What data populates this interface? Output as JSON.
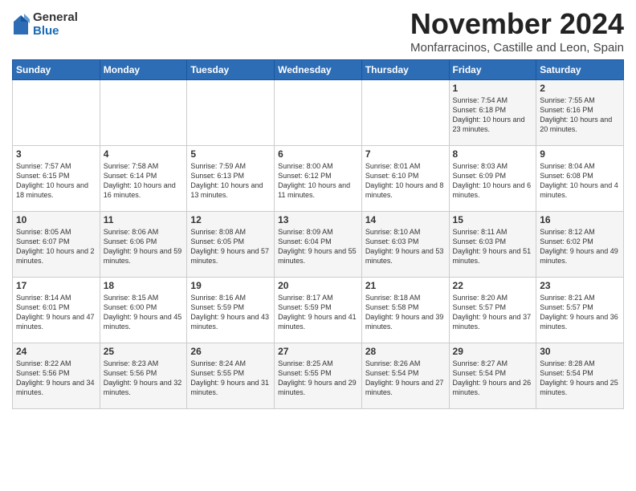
{
  "header": {
    "logo_general": "General",
    "logo_blue": "Blue",
    "month_title": "November 2024",
    "subtitle": "Monfarracinos, Castille and Leon, Spain"
  },
  "weekdays": [
    "Sunday",
    "Monday",
    "Tuesday",
    "Wednesday",
    "Thursday",
    "Friday",
    "Saturday"
  ],
  "weeks": [
    [
      {
        "day": "",
        "info": ""
      },
      {
        "day": "",
        "info": ""
      },
      {
        "day": "",
        "info": ""
      },
      {
        "day": "",
        "info": ""
      },
      {
        "day": "",
        "info": ""
      },
      {
        "day": "1",
        "info": "Sunrise: 7:54 AM\nSunset: 6:18 PM\nDaylight: 10 hours and 23 minutes."
      },
      {
        "day": "2",
        "info": "Sunrise: 7:55 AM\nSunset: 6:16 PM\nDaylight: 10 hours and 20 minutes."
      }
    ],
    [
      {
        "day": "3",
        "info": "Sunrise: 7:57 AM\nSunset: 6:15 PM\nDaylight: 10 hours and 18 minutes."
      },
      {
        "day": "4",
        "info": "Sunrise: 7:58 AM\nSunset: 6:14 PM\nDaylight: 10 hours and 16 minutes."
      },
      {
        "day": "5",
        "info": "Sunrise: 7:59 AM\nSunset: 6:13 PM\nDaylight: 10 hours and 13 minutes."
      },
      {
        "day": "6",
        "info": "Sunrise: 8:00 AM\nSunset: 6:12 PM\nDaylight: 10 hours and 11 minutes."
      },
      {
        "day": "7",
        "info": "Sunrise: 8:01 AM\nSunset: 6:10 PM\nDaylight: 10 hours and 8 minutes."
      },
      {
        "day": "8",
        "info": "Sunrise: 8:03 AM\nSunset: 6:09 PM\nDaylight: 10 hours and 6 minutes."
      },
      {
        "day": "9",
        "info": "Sunrise: 8:04 AM\nSunset: 6:08 PM\nDaylight: 10 hours and 4 minutes."
      }
    ],
    [
      {
        "day": "10",
        "info": "Sunrise: 8:05 AM\nSunset: 6:07 PM\nDaylight: 10 hours and 2 minutes."
      },
      {
        "day": "11",
        "info": "Sunrise: 8:06 AM\nSunset: 6:06 PM\nDaylight: 9 hours and 59 minutes."
      },
      {
        "day": "12",
        "info": "Sunrise: 8:08 AM\nSunset: 6:05 PM\nDaylight: 9 hours and 57 minutes."
      },
      {
        "day": "13",
        "info": "Sunrise: 8:09 AM\nSunset: 6:04 PM\nDaylight: 9 hours and 55 minutes."
      },
      {
        "day": "14",
        "info": "Sunrise: 8:10 AM\nSunset: 6:03 PM\nDaylight: 9 hours and 53 minutes."
      },
      {
        "day": "15",
        "info": "Sunrise: 8:11 AM\nSunset: 6:03 PM\nDaylight: 9 hours and 51 minutes."
      },
      {
        "day": "16",
        "info": "Sunrise: 8:12 AM\nSunset: 6:02 PM\nDaylight: 9 hours and 49 minutes."
      }
    ],
    [
      {
        "day": "17",
        "info": "Sunrise: 8:14 AM\nSunset: 6:01 PM\nDaylight: 9 hours and 47 minutes."
      },
      {
        "day": "18",
        "info": "Sunrise: 8:15 AM\nSunset: 6:00 PM\nDaylight: 9 hours and 45 minutes."
      },
      {
        "day": "19",
        "info": "Sunrise: 8:16 AM\nSunset: 5:59 PM\nDaylight: 9 hours and 43 minutes."
      },
      {
        "day": "20",
        "info": "Sunrise: 8:17 AM\nSunset: 5:59 PM\nDaylight: 9 hours and 41 minutes."
      },
      {
        "day": "21",
        "info": "Sunrise: 8:18 AM\nSunset: 5:58 PM\nDaylight: 9 hours and 39 minutes."
      },
      {
        "day": "22",
        "info": "Sunrise: 8:20 AM\nSunset: 5:57 PM\nDaylight: 9 hours and 37 minutes."
      },
      {
        "day": "23",
        "info": "Sunrise: 8:21 AM\nSunset: 5:57 PM\nDaylight: 9 hours and 36 minutes."
      }
    ],
    [
      {
        "day": "24",
        "info": "Sunrise: 8:22 AM\nSunset: 5:56 PM\nDaylight: 9 hours and 34 minutes."
      },
      {
        "day": "25",
        "info": "Sunrise: 8:23 AM\nSunset: 5:56 PM\nDaylight: 9 hours and 32 minutes."
      },
      {
        "day": "26",
        "info": "Sunrise: 8:24 AM\nSunset: 5:55 PM\nDaylight: 9 hours and 31 minutes."
      },
      {
        "day": "27",
        "info": "Sunrise: 8:25 AM\nSunset: 5:55 PM\nDaylight: 9 hours and 29 minutes."
      },
      {
        "day": "28",
        "info": "Sunrise: 8:26 AM\nSunset: 5:54 PM\nDaylight: 9 hours and 27 minutes."
      },
      {
        "day": "29",
        "info": "Sunrise: 8:27 AM\nSunset: 5:54 PM\nDaylight: 9 hours and 26 minutes."
      },
      {
        "day": "30",
        "info": "Sunrise: 8:28 AM\nSunset: 5:54 PM\nDaylight: 9 hours and 25 minutes."
      }
    ]
  ]
}
